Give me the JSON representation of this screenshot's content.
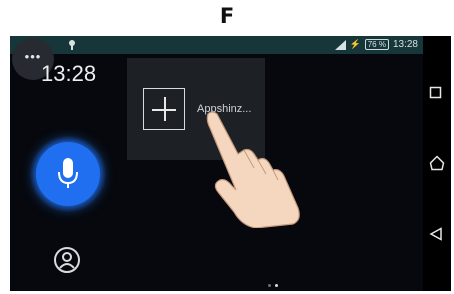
{
  "panel_label": "F",
  "status_bar": {
    "time": "13:28",
    "battery": "76 %"
  },
  "home": {
    "clock": "13:28",
    "overflow_menu": "•••",
    "widget_label": "Appshinz..."
  },
  "colors": {
    "status_bar": "#17363a",
    "mic_accent": "#1f6ff0",
    "background": "#06080d"
  }
}
